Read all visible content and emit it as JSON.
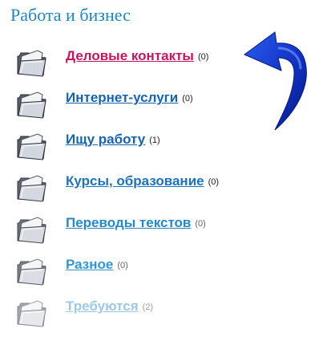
{
  "section": {
    "title": "Работа и бизнес"
  },
  "categories": [
    {
      "label": "Деловые контакты ",
      "count": "(0)",
      "color": "#c8155f"
    },
    {
      "label": "Интернет-услуги",
      "count": "(0)",
      "color": "#1464b4"
    },
    {
      "label": "Ищу работу",
      "count": "(1)",
      "color": "#1464b4"
    },
    {
      "label": "Курсы, образование",
      "count": "(0)",
      "color": "#1a73c0"
    },
    {
      "label": "Переводы текстов",
      "count": "(0)",
      "color": "#2388cc"
    },
    {
      "label": "Разное",
      "count": "(0)",
      "color": "#2f97d6"
    },
    {
      "label": "Требуются",
      "count": "(2)",
      "color": "#9ec8e8"
    }
  ],
  "colors": {
    "title": "#1a86c8",
    "arrow": "#1040c8"
  },
  "icons": {
    "folder": "folder-icon",
    "arrow": "return-arrow-icon"
  }
}
